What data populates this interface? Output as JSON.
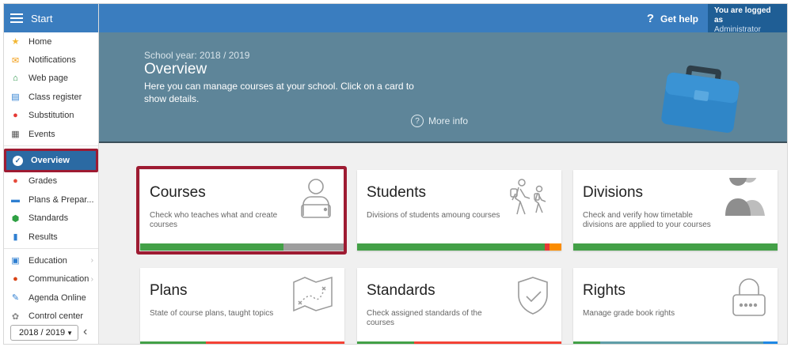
{
  "sidebar": {
    "title": "Start",
    "items": [
      {
        "label": "Home",
        "icon": "star-icon",
        "glyph": "★",
        "color": "#f2b632"
      },
      {
        "label": "Notifications",
        "icon": "envelope-icon",
        "glyph": "✉",
        "color": "#f39c12"
      },
      {
        "label": "Web page",
        "icon": "home-icon",
        "glyph": "⌂",
        "color": "#1e8e3e"
      },
      {
        "label": "Class register",
        "icon": "register-icon",
        "glyph": "▤",
        "color": "#2f7fd1"
      },
      {
        "label": "Substitution",
        "icon": "person-icon",
        "glyph": "●",
        "color": "#e53935"
      },
      {
        "label": "Events",
        "icon": "calendar-icon",
        "glyph": "▦",
        "color": "#555555"
      }
    ],
    "active_item": {
      "label": "Overview",
      "icon": "check-circle-icon",
      "glyph": "✓"
    },
    "items2": [
      {
        "label": "Grades",
        "icon": "grades-icon",
        "glyph": "●",
        "color": "#e64a3b"
      },
      {
        "label": "Plans & Prepar...",
        "icon": "briefcase-icon",
        "glyph": "▬",
        "color": "#2f7fd1"
      },
      {
        "label": "Standards",
        "icon": "shield-icon",
        "glyph": "⬢",
        "color": "#2ea043"
      },
      {
        "label": "Results",
        "icon": "bar-chart-icon",
        "glyph": "▮",
        "color": "#2f7fd1"
      }
    ],
    "items3": [
      {
        "label": "Education",
        "icon": "education-icon",
        "glyph": "▣",
        "color": "#2f7fd1",
        "has_sub": true
      },
      {
        "label": "Communication",
        "icon": "chat-icon",
        "glyph": "●",
        "color": "#d84315",
        "has_sub": true
      },
      {
        "label": "Agenda Online",
        "icon": "pen-icon",
        "glyph": "✎",
        "color": "#2f7fd1",
        "has_sub": false
      },
      {
        "label": "Control center",
        "icon": "gear-icon",
        "glyph": "✿",
        "color": "#888888",
        "has_sub": false
      }
    ],
    "year_select": "2018 / 2019"
  },
  "topbar": {
    "help_label": "Get help",
    "login_line1": "You are logged as",
    "login_line2": "Administrator"
  },
  "banner": {
    "school_year": "School year: 2018 / 2019",
    "title": "Overview",
    "description": "Here you can manage courses at your school. Click on a card to show details.",
    "more_info": "More info"
  },
  "cards": [
    {
      "title": "Courses",
      "desc": "Check who teaches what and create courses",
      "icon": "person-laptop-icon",
      "bar": [
        {
          "pct": 70,
          "color": "#43a047"
        },
        {
          "pct": 30,
          "color": "#9e9e9e"
        }
      ]
    },
    {
      "title": "Students",
      "desc": "Divisions of students amoung courses",
      "icon": "students-walking-icon",
      "bar": [
        {
          "pct": 92,
          "color": "#43a047"
        },
        {
          "pct": 2,
          "color": "#e53935"
        },
        {
          "pct": 6,
          "color": "#fb8c00"
        }
      ]
    },
    {
      "title": "Divisions",
      "desc": "Check and verify how timetable divisions are applied to your courses",
      "icon": "people-silhouette-icon",
      "bar": [
        {
          "pct": 100,
          "color": "#43a047"
        }
      ]
    },
    {
      "title": "Plans",
      "desc": "State of course plans, taught topics",
      "icon": "map-icon",
      "bar": [
        {
          "pct": 32,
          "color": "#43a047"
        },
        {
          "pct": 68,
          "color": "#f44336"
        }
      ]
    },
    {
      "title": "Standards",
      "desc": "Check assigned standards of the courses",
      "icon": "shield-check-icon",
      "bar": [
        {
          "pct": 28,
          "color": "#43a047"
        },
        {
          "pct": 72,
          "color": "#f44336"
        }
      ]
    },
    {
      "title": "Rights",
      "desc": "Manage grade book rights",
      "icon": "padlock-icon",
      "bar": [
        {
          "pct": 13,
          "color": "#43a047"
        },
        {
          "pct": 80,
          "color": "#5f9ea8"
        },
        {
          "pct": 7,
          "color": "#1e88e5"
        }
      ]
    }
  ]
}
